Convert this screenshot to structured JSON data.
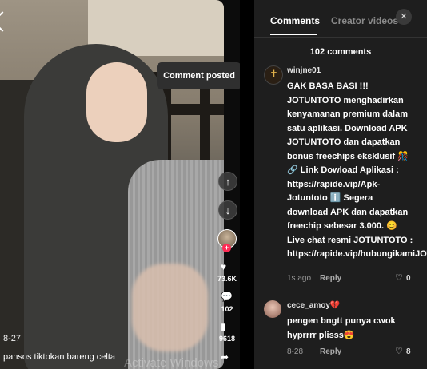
{
  "toast": {
    "text": "Comment posted"
  },
  "video": {
    "like_count": "73.6K",
    "comment_count": "102",
    "save_count": "9618",
    "date": "8-27",
    "caption": "pansos tiktokan bareng celta",
    "watermark": "Activate Windows"
  },
  "panel": {
    "tabs": [
      "Comments",
      "Creator videos"
    ],
    "close_icon": "✕",
    "comment_total": "102 comments",
    "comments": [
      {
        "username": "winjne01",
        "text": "GAK BASA BASI !!! JOTUNTOTO menghadirkan kenyamanan premium dalam satu aplikasi. Download APK JOTUNTOTO dan dapatkan bonus freechips eksklusif 🎊 🔗 Link Dowload Aplikasi : https://rapide.vip/Apk-Jotuntoto ℹ️ Segera download APK dan dapatkan freechip sebesar 3.000. 😊 Live chat resmi JOTUNTOTO : https://rapide.vip/hubungikamiJOTUNTOTO",
        "date": "1s ago",
        "reply": "Reply",
        "likes": "0"
      },
      {
        "username": "cece_amoy💔",
        "text": "pengen bngtt punya cwok hyprrrr plisss😍",
        "date": "8-28",
        "reply": "Reply",
        "likes": "8"
      }
    ]
  },
  "colors": {
    "panel_bg": "#1e1e1e",
    "accent": "#fe2c55"
  },
  "icons": [
    "back-chevron-icon",
    "arrow-up-icon",
    "arrow-down-icon",
    "heart-icon",
    "comment-icon",
    "bookmark-icon",
    "share-icon",
    "close-icon",
    "heart-outline-icon"
  ]
}
